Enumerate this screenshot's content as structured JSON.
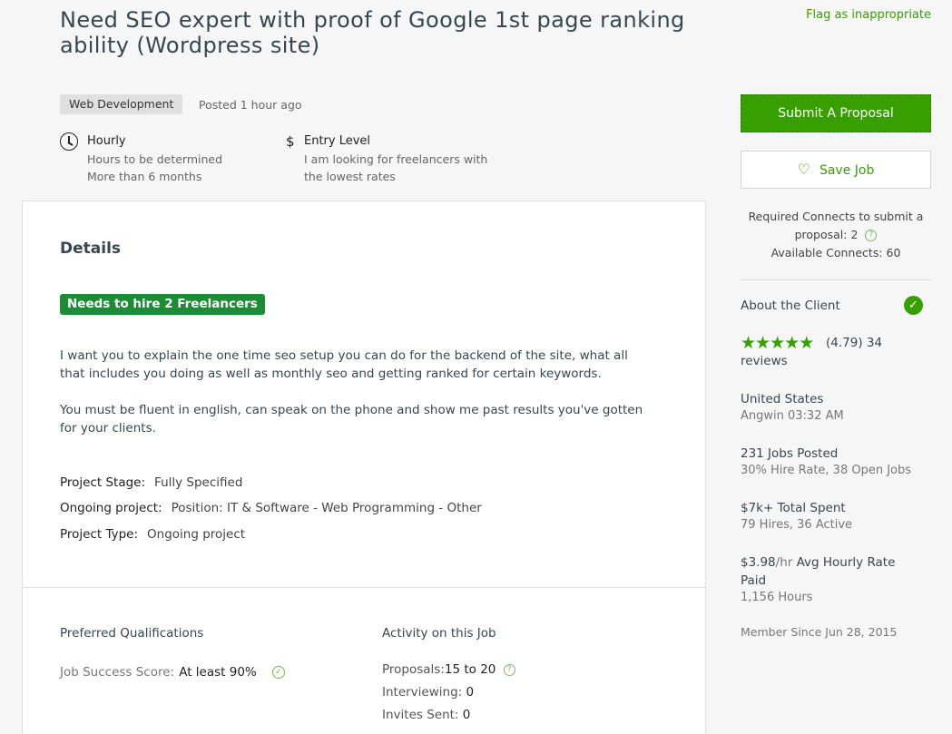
{
  "job": {
    "title": "Need SEO expert with proof of Google 1st page ranking ability (Wordpress site)",
    "flag_label": "Flag as inappropriate",
    "category": "Web Development",
    "posted": "Posted 1 hour ago",
    "type_title": "Hourly",
    "type_line1": "Hours to be determined",
    "type_line2": "More than 6 months",
    "level_icon": "$",
    "level_title": "Entry Level",
    "level_line1": "I am looking for freelancers with",
    "level_line2": "the lowest rates"
  },
  "details": {
    "heading": "Details",
    "hire_badge": "Needs to hire 2 Freelancers",
    "para1_line1": "I want you to explain the one time seo setup you can do for the backend of the site, what all",
    "para1_line2": "that includes you doing as well as monthly seo and getting ranked for certain keywords.",
    "para2_line1": "You must be fluent in english, can speak on the phone and show me past results you've gotten",
    "para2_line2": "for your clients.",
    "attributes": [
      {
        "label": "Project Stage:",
        "value": "Fully Specified"
      },
      {
        "label": "Ongoing project:",
        "value": "Position: IT & Software - Web Programming - Other"
      },
      {
        "label": "Project Type:",
        "value": "Ongoing project"
      }
    ]
  },
  "qualifications": {
    "heading": "Preferred Qualifications",
    "jss_label": "Job Success Score:",
    "jss_value": "At least 90%"
  },
  "activity": {
    "heading": "Activity on this Job",
    "proposals_label": "Proposals:",
    "proposals_value": "15 to 20",
    "interviewing_label": "Interviewing:",
    "interviewing_value": "0",
    "invites_label": "Invites Sent:",
    "invites_value": "0"
  },
  "sidebar": {
    "submit_label": "Submit A Proposal",
    "save_label": "Save Job",
    "connects_line1": "Required Connects to submit a",
    "connects_line2": "proposal: 2",
    "connects_line3": "Available Connects: 60",
    "about_label": "About the Client",
    "rating": "(4.79) 34",
    "reviews": "reviews",
    "location": "United States",
    "local_time": "Angwin 03:32 AM",
    "jobs_posted": "231 Jobs Posted",
    "hire_rate": "30% Hire Rate, 38 Open Jobs",
    "total_spent": "$7k+ Total Spent",
    "hires": "79 Hires, 36 Active",
    "avg_rate_value": "$3.98",
    "avg_rate_unit": "/hr",
    "avg_rate_label1": " Avg Hourly Rate",
    "avg_rate_label2": "Paid",
    "hours": "1,156 Hours",
    "member_since": "Member Since Jun 28, 2015"
  },
  "colors": {
    "accent": "#37a000",
    "hire_badge": "#1e8c34"
  },
  "icons": {
    "type": "clock-icon",
    "save": "heart-icon",
    "verified": "check-circle-icon",
    "help": "question-circle-icon",
    "rating": "star-icon"
  }
}
